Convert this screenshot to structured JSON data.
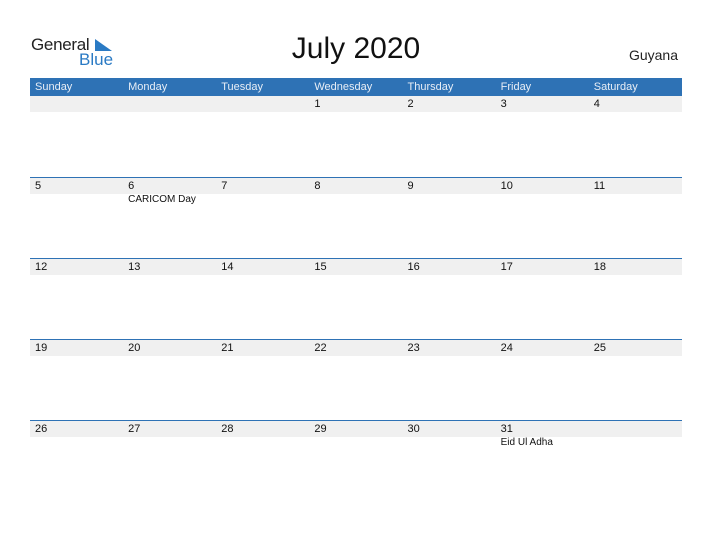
{
  "logo": {
    "general": "General",
    "blue": "Blue"
  },
  "title": "July 2020",
  "country": "Guyana",
  "days": [
    "Sunday",
    "Monday",
    "Tuesday",
    "Wednesday",
    "Thursday",
    "Friday",
    "Saturday"
  ],
  "weeks": [
    [
      {
        "d": ""
      },
      {
        "d": ""
      },
      {
        "d": ""
      },
      {
        "d": "1"
      },
      {
        "d": "2"
      },
      {
        "d": "3"
      },
      {
        "d": "4"
      }
    ],
    [
      {
        "d": "5"
      },
      {
        "d": "6",
        "e": "CARICOM Day"
      },
      {
        "d": "7"
      },
      {
        "d": "8"
      },
      {
        "d": "9"
      },
      {
        "d": "10"
      },
      {
        "d": "11"
      }
    ],
    [
      {
        "d": "12"
      },
      {
        "d": "13"
      },
      {
        "d": "14"
      },
      {
        "d": "15"
      },
      {
        "d": "16"
      },
      {
        "d": "17"
      },
      {
        "d": "18"
      }
    ],
    [
      {
        "d": "19"
      },
      {
        "d": "20"
      },
      {
        "d": "21"
      },
      {
        "d": "22"
      },
      {
        "d": "23"
      },
      {
        "d": "24"
      },
      {
        "d": "25"
      }
    ],
    [
      {
        "d": "26"
      },
      {
        "d": "27"
      },
      {
        "d": "28"
      },
      {
        "d": "29"
      },
      {
        "d": "30"
      },
      {
        "d": "31",
        "e": "Eid Ul Adha"
      },
      {
        "d": ""
      }
    ]
  ],
  "colors": {
    "accent": "#2e72b5",
    "strip": "#f0f0f0",
    "logo_blue": "#2a7ac4"
  }
}
